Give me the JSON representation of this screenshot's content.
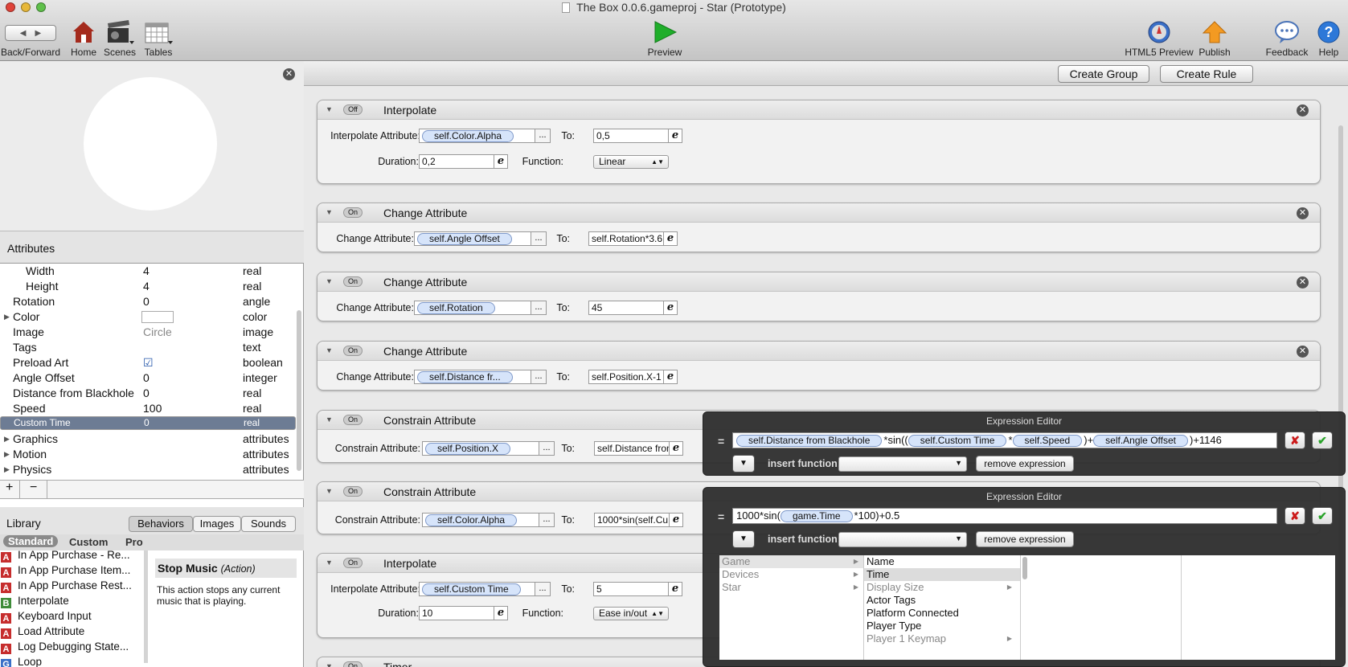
{
  "window": {
    "title": "The Box 0.0.6.gameproj - Star (Prototype)"
  },
  "toolbar": {
    "back_forward": "Back/Forward",
    "home": "Home",
    "scenes": "Scenes",
    "tables": "Tables",
    "preview": "Preview",
    "html5": "HTML5 Preview",
    "publish": "Publish",
    "feedback": "Feedback",
    "help": "Help"
  },
  "attributes": {
    "header": "Attributes",
    "rows": [
      {
        "name": "Width",
        "value": "4",
        "type": "real"
      },
      {
        "name": "Height",
        "value": "4",
        "type": "real"
      },
      {
        "name": "Rotation",
        "value": "0",
        "type": "angle"
      },
      {
        "name": "Color",
        "value": "",
        "type": "color"
      },
      {
        "name": "Image",
        "value": "Circle",
        "type": "image"
      },
      {
        "name": "Tags",
        "value": "",
        "type": "text"
      },
      {
        "name": "Preload Art",
        "value": "☑",
        "type": "boolean"
      },
      {
        "name": "Angle Offset",
        "value": "0",
        "type": "integer"
      },
      {
        "name": "Distance from Blackhole",
        "value": "0",
        "type": "real"
      },
      {
        "name": "Speed",
        "value": "100",
        "type": "real"
      },
      {
        "name": "Custom Time",
        "value": "0",
        "type": "real"
      },
      {
        "name": "Graphics",
        "value": "",
        "type": "attributes"
      },
      {
        "name": "Motion",
        "value": "",
        "type": "attributes"
      },
      {
        "name": "Physics",
        "value": "",
        "type": "attributes"
      }
    ],
    "add": "+",
    "remove": "−"
  },
  "library": {
    "title": "Library",
    "tabs": [
      "Behaviors",
      "Images",
      "Sounds"
    ],
    "subtabs": [
      "Standard",
      "Custom",
      "Pro"
    ],
    "items": [
      {
        "badge": "A",
        "label": "In App Purchase - Re..."
      },
      {
        "badge": "A",
        "label": "In App Purchase Item..."
      },
      {
        "badge": "A",
        "label": "In App Purchase Rest..."
      },
      {
        "badge": "B",
        "label": "Interpolate"
      },
      {
        "badge": "A",
        "label": "Keyboard Input"
      },
      {
        "badge": "A",
        "label": "Load Attribute"
      },
      {
        "badge": "A",
        "label": "Log Debugging State..."
      },
      {
        "badge": "G",
        "label": "Loop"
      }
    ],
    "detail_title": "Stop Music",
    "detail_kind": "(Action)",
    "detail_text": "This action stops any current music that is playing."
  },
  "main": {
    "create_group": "Create Group",
    "create_rule": "Create Rule",
    "behaviors": [
      {
        "state": "Off",
        "name": "Interpolate",
        "l1": "Interpolate Attribute:",
        "attr": "self.Color.Alpha",
        "to_label": "To:",
        "to": "0,5",
        "dur_label": "Duration:",
        "dur": "0,2",
        "fn_label": "Function:",
        "fn": "Linear"
      },
      {
        "state": "On",
        "name": "Change Attribute",
        "l1": "Change Attribute:",
        "attr": "self.Angle Offset",
        "to_label": "To:",
        "to": "self.Rotation*3.6"
      },
      {
        "state": "On",
        "name": "Change Attribute",
        "l1": "Change Attribute:",
        "attr": "self.Rotation",
        "to_label": "To:",
        "to": "45"
      },
      {
        "state": "On",
        "name": "Change Attribute",
        "l1": "Change Attribute:",
        "attr": "self.Distance fr...",
        "to_label": "To:",
        "to": "self.Position.X-1"
      },
      {
        "state": "On",
        "name": "Constrain Attribute",
        "l1": "Constrain Attribute:",
        "attr": "self.Position.X",
        "to_label": "To:",
        "to": "self.Distance from"
      },
      {
        "state": "On",
        "name": "Constrain Attribute",
        "l1": "Constrain Attribute:",
        "attr": "self.Color.Alpha",
        "to_label": "To:",
        "to": "1000*sin(self.Cu"
      },
      {
        "state": "On",
        "name": "Interpolate",
        "l1": "Interpolate Attribute:",
        "attr": "self.Custom Time",
        "to_label": "To:",
        "to": "5",
        "dur_label": "Duration:",
        "dur": "10",
        "fn_label": "Function:",
        "fn": "Ease in/out"
      },
      {
        "state": "On",
        "name": "Timer"
      }
    ]
  },
  "expr1": {
    "title": "Expression Editor",
    "eq": "=",
    "p1": "self.Distance from Blackhole",
    "t1": "*sin((",
    "p2": "self.Custom Time",
    "t2": "*",
    "p3": "self.Speed",
    "t3": ")+",
    "p4": "self.Angle Offset",
    "t4": ")+1146",
    "insert": "insert function:",
    "remove": "remove expression"
  },
  "expr2": {
    "title": "Expression Editor",
    "eq": "=",
    "t0": "1000*sin(",
    "p1": "game.Time",
    "t1": "*100)+0.5",
    "insert": "insert function:",
    "remove": "remove expression",
    "col1": [
      "Game",
      "Devices",
      "Star"
    ],
    "col2": [
      "Name",
      "Time",
      "Display Size",
      "Actor Tags",
      "Platform Connected",
      "Player Type",
      "Player 1 Keymap"
    ]
  },
  "colors": {
    "selection": "#6d7c94",
    "pill": "#d6e4fa",
    "green": "#2aa32a",
    "red": "#cc1a1a"
  }
}
